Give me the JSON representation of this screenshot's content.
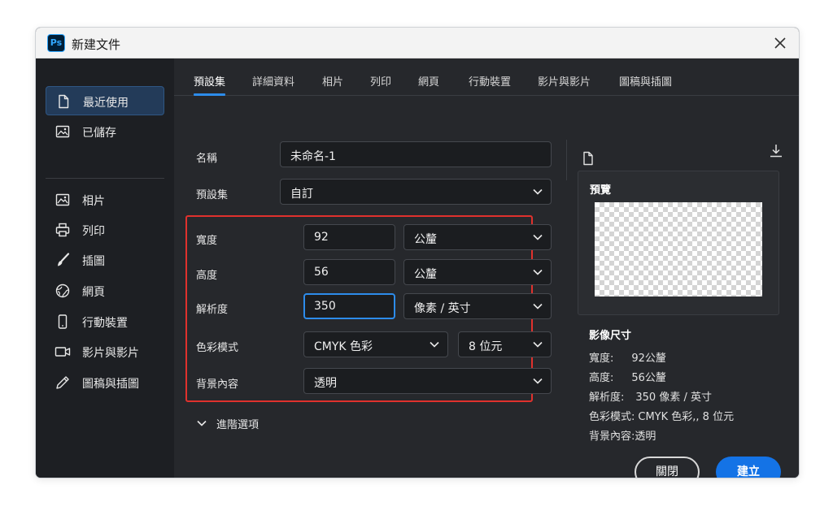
{
  "window": {
    "app_icon": "Ps",
    "title": "新建文件",
    "close_icon": "close-icon"
  },
  "sidebar": {
    "items": [
      {
        "label": "最近使用",
        "icon": "document-icon",
        "active": true
      },
      {
        "label": "已儲存",
        "icon": "image-icon",
        "active": false
      },
      {
        "label": "相片",
        "icon": "photo-icon",
        "active": false
      },
      {
        "label": "列印",
        "icon": "printer-icon",
        "active": false
      },
      {
        "label": "插圖",
        "icon": "brush-icon",
        "active": false
      },
      {
        "label": "網頁",
        "icon": "globe-icon",
        "active": false
      },
      {
        "label": "行動裝置",
        "icon": "mobile-icon",
        "active": false
      },
      {
        "label": "影片與影片",
        "icon": "video-icon",
        "active": false
      },
      {
        "label": "圖稿與插圖",
        "icon": "pencil-icon",
        "active": false
      }
    ]
  },
  "tabs": [
    {
      "label": "預設集",
      "active": true
    },
    {
      "label": "詳細資料",
      "active": false
    },
    {
      "label": "相片",
      "active": false
    },
    {
      "label": "列印",
      "active": false
    },
    {
      "label": "網頁",
      "active": false
    },
    {
      "label": "行動裝置",
      "active": false
    },
    {
      "label": "影片與影片",
      "active": false
    },
    {
      "label": "圖稿與插圖",
      "active": false
    }
  ],
  "form": {
    "name_label": "名稱",
    "name_value": "未命名-1",
    "preset_label": "預設集",
    "preset_value": "自訂",
    "width_label": "寬度",
    "width_value": "92",
    "width_unit": "公釐",
    "height_label": "高度",
    "height_value": "56",
    "height_unit": "公釐",
    "resolution_label": "解析度",
    "resolution_value": "350",
    "resolution_unit": "像素 / 英寸",
    "color_mode_label": "色彩模式",
    "color_mode_value": "CMYK 色彩",
    "bit_depth_value": "8 位元",
    "background_label": "背景內容",
    "background_value": "透明",
    "advanced_label": "進階選項"
  },
  "preview": {
    "title": "預覽"
  },
  "image_size": {
    "title": "影像尺寸",
    "lines": [
      {
        "k": "寬度:",
        "v": "92公釐"
      },
      {
        "k": "高度:",
        "v": "56公釐"
      },
      {
        "k": "解析度:",
        "v": "350 像素 / 英寸"
      },
      {
        "k": "色彩模式:",
        "v": "CMYK 色彩,, 8 位元"
      },
      {
        "k": "背景內容:",
        "v": "透明"
      }
    ]
  },
  "buttons": {
    "cancel": "關閉",
    "create": "建立"
  },
  "colors": {
    "accent": "#1473e6",
    "highlight_border": "#e0312d",
    "panel_bg": "#26282c",
    "sidebar_bg": "#1d1f23"
  }
}
